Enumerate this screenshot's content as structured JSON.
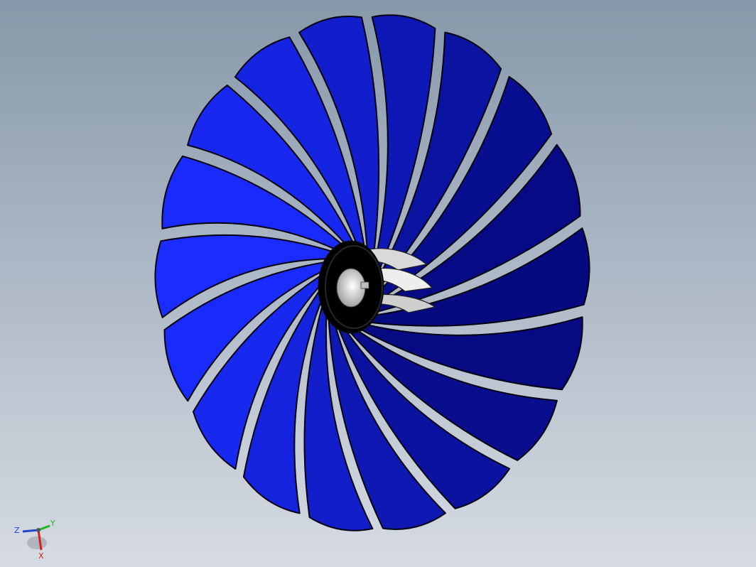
{
  "view": {
    "background_top": "#8798aa",
    "background_bottom": "#d6dbe3"
  },
  "model": {
    "blade_count": 18,
    "blade_color_light": "#1a2cff",
    "blade_color_dark": "#02046a",
    "hub_color": "#000000",
    "bore_color": "#ffffff"
  },
  "triad": {
    "x_label": "X",
    "y_label": "Y",
    "z_label": "Z",
    "x_color": "#d81c1c",
    "y_color": "#22b422",
    "z_color": "#2244cc"
  }
}
